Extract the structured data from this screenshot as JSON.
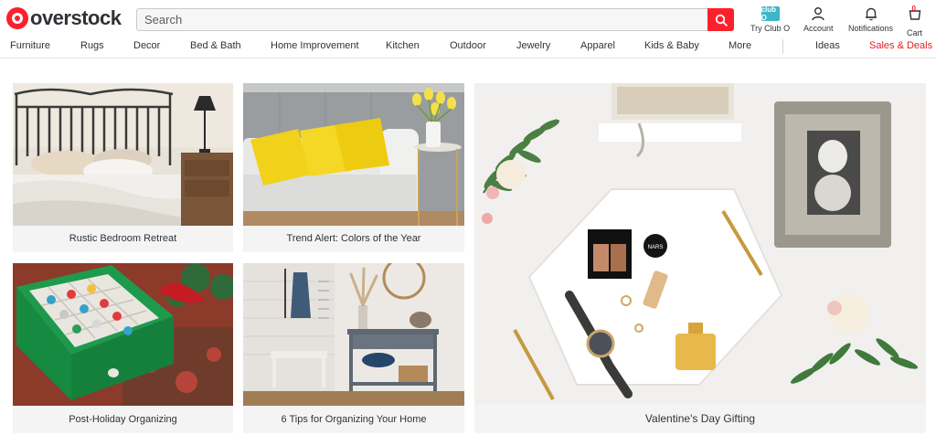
{
  "header": {
    "logo_text": "overstock",
    "search_placeholder": "Search",
    "club_label": "Try Club O",
    "club_icon_text": "club O",
    "account_label": "Account",
    "notifications_label": "Notifications",
    "cart_label": "Cart",
    "cart_count": "0"
  },
  "nav": {
    "items": [
      "Furniture",
      "Rugs",
      "Decor",
      "Bed & Bath",
      "Home Improvement",
      "Kitchen",
      "Outdoor",
      "Jewelry",
      "Apparel",
      "Kids & Baby",
      "More"
    ],
    "ideas": "Ideas",
    "sales": "Sales & Deals"
  },
  "tiles": [
    {
      "caption": "Rustic Bedroom Retreat"
    },
    {
      "caption": "Trend Alert: Colors of the Year"
    },
    {
      "caption": "Post-Holiday Organizing"
    },
    {
      "caption": "6 Tips for Organizing Your Home"
    },
    {
      "caption": "Valentine's Day Gifting"
    }
  ],
  "product_text": {
    "nars": "NARS"
  },
  "colors": {
    "brand_red": "#ff1f2c",
    "sales_red": "#e61c24",
    "club_teal": "#3db7c7"
  }
}
